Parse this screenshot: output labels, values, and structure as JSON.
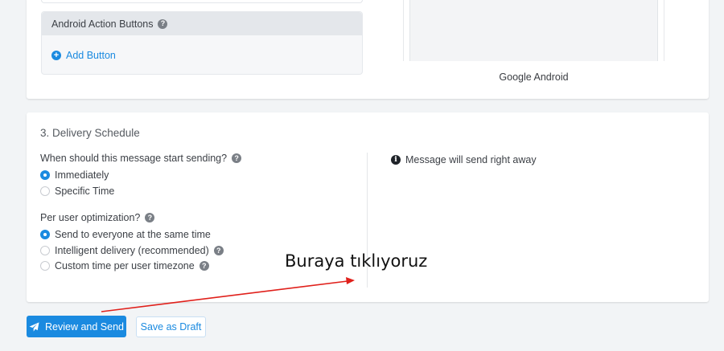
{
  "platform_card": {
    "android_buttons_header": "Android Action Buttons",
    "add_button_label": "Add Button",
    "preview_label": "Google Android"
  },
  "delivery": {
    "section_title": "3. Delivery Schedule",
    "start_question": "When should this message start sending?",
    "start_options": [
      {
        "label": "Immediately",
        "checked": true
      },
      {
        "label": "Specific Time",
        "checked": false
      }
    ],
    "optimization_question": "Per user optimization?",
    "optimization_options": [
      {
        "label": "Send to everyone at the same time",
        "checked": true
      },
      {
        "label": "Intelligent delivery (recommended)",
        "checked": false
      },
      {
        "label": "Custom time per user timezone",
        "checked": false
      }
    ],
    "info_message": "Message will send right away"
  },
  "actions": {
    "review_label": "Review and Send",
    "draft_label": "Save as Draft"
  },
  "annotation": {
    "text": "Buraya tıklıyoruz",
    "color": "#e0201b"
  },
  "colors": {
    "accent": "#1a8ae0",
    "page_bg": "#f2f4f6"
  },
  "icons": {
    "help": "question-circle",
    "add": "plus-circle",
    "info": "info-circle",
    "send": "paper-plane"
  }
}
